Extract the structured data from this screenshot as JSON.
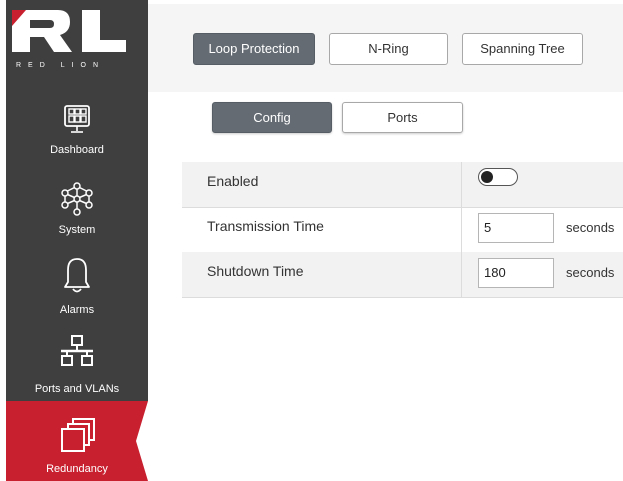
{
  "brand": {
    "logo_letters": "RL",
    "logo_text": "RED LION",
    "accent": "#c8202f",
    "sidebar_bg": "#3f3f3f"
  },
  "sidebar": {
    "items": [
      {
        "label": "Dashboard",
        "icon": "dashboard-icon"
      },
      {
        "label": "System",
        "icon": "system-network-icon"
      },
      {
        "label": "Alarms",
        "icon": "bell-icon"
      },
      {
        "label": "Ports and VLANs",
        "icon": "network-topology-icon"
      },
      {
        "label": "Redundancy",
        "icon": "redundancy-stack-icon",
        "active": true
      }
    ]
  },
  "tabs": [
    {
      "label": "Loop Protection",
      "active": true
    },
    {
      "label": "N-Ring",
      "active": false
    },
    {
      "label": "Spanning Tree",
      "active": false
    }
  ],
  "subtabs": [
    {
      "label": "Config",
      "active": true
    },
    {
      "label": "Ports",
      "active": false
    }
  ],
  "settings": {
    "enabled": {
      "label": "Enabled",
      "value": false
    },
    "transmission_time": {
      "label": "Transmission Time",
      "value": "5",
      "unit": "seconds"
    },
    "shutdown_time": {
      "label": "Shutdown Time",
      "value": "180",
      "unit": "seconds"
    }
  }
}
